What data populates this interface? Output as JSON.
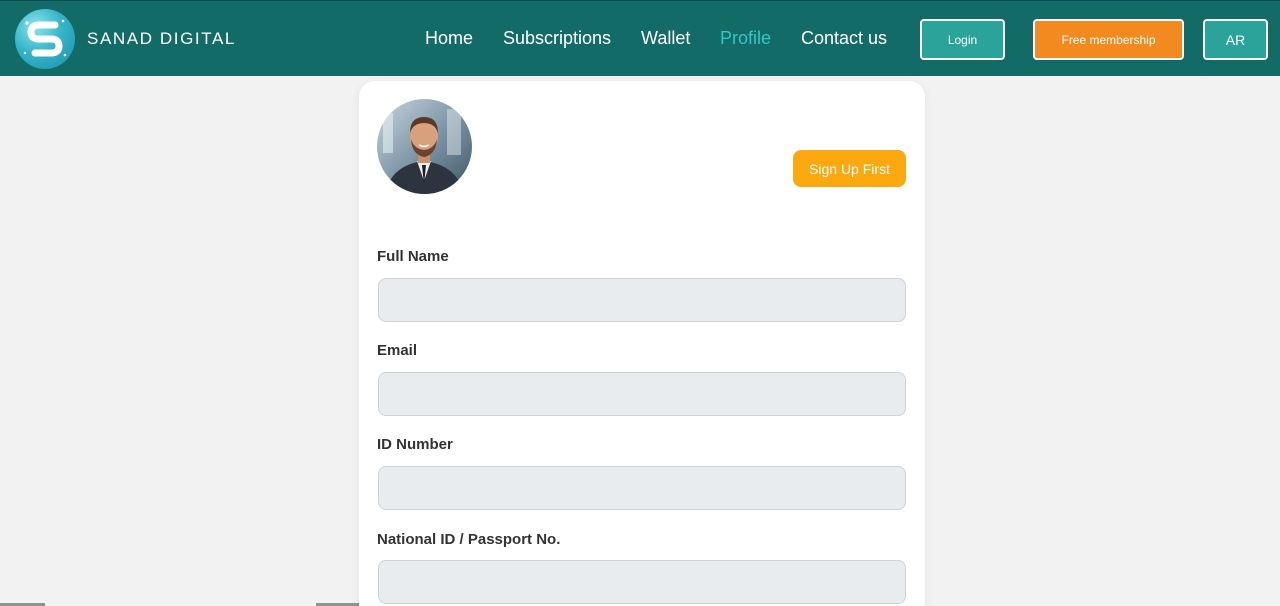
{
  "brand": {
    "name": "SANAD DIGITAL",
    "accent_color": "#136b67",
    "logo_icon": "s-logo-icon"
  },
  "nav": {
    "items": [
      {
        "label": "Home",
        "active": false
      },
      {
        "label": "Subscriptions",
        "active": false
      },
      {
        "label": "Wallet",
        "active": false
      },
      {
        "label": "Profile",
        "active": true
      },
      {
        "label": "Contact us",
        "active": false
      }
    ],
    "login_label": "Login",
    "free_membership_label": "Free membership",
    "language_label": "AR"
  },
  "profile": {
    "avatar": "user-avatar-photo",
    "signup_label": "Sign Up First",
    "fields": [
      {
        "label": "Full Name",
        "value": "",
        "placeholder": ""
      },
      {
        "label": "Email",
        "value": "",
        "placeholder": ""
      },
      {
        "label": "ID Number",
        "value": "",
        "placeholder": ""
      },
      {
        "label": "National ID / Passport No.",
        "value": "",
        "placeholder": ""
      }
    ]
  },
  "colors": {
    "header_bg": "#136b67",
    "active_link": "#35c6c7",
    "login_bg": "#2aa39a",
    "free_membership_bg": "#f38a1f",
    "signup_bg": "#fca80f",
    "page_bg": "#f2f2f2",
    "input_bg": "#e9ecef"
  }
}
